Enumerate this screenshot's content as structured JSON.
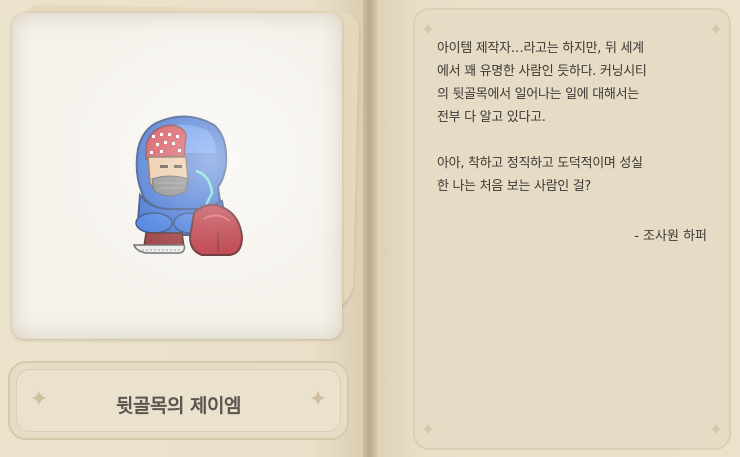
{
  "character": {
    "name": "뒷골목의 제이엠",
    "portrait_icon": "hooded-character-sprite"
  },
  "dialog": {
    "paragraph_1": "아이템 제작자…라고는 하지만, 뒤 세계\n에서 꽤 유명한 사람인 듯하다. 커닝시티\n의 뒷골목에서 일어나는 일에 대해서는\n전부 다 알고 있다고.",
    "paragraph_2": "아아, 착하고 정직하고 도덕적이며 성실\n한 나는 처음 보는 사람인 걸?",
    "signature": "- 조사원 하퍼"
  },
  "colors": {
    "page": "#e7ddc6",
    "text": "#3d3834",
    "name_text": "#5c5650",
    "hood_blue": "#1a56c8",
    "bandana_red": "#c8202a",
    "bag_red": "#b01824"
  }
}
